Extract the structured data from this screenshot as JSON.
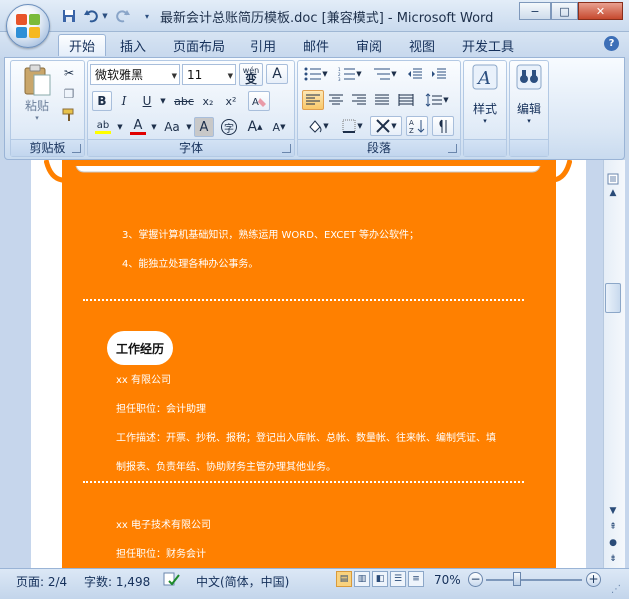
{
  "window": {
    "title": "最新会计总账简历模板.doc [兼容模式] - Microsoft Word",
    "minimize": "−",
    "maximize": "□",
    "close": "✕"
  },
  "qat": {
    "save_icon": "save-icon",
    "undo_icon": "undo-icon",
    "redo_icon": "redo-icon"
  },
  "tabs": [
    "开始",
    "插入",
    "页面布局",
    "引用",
    "邮件",
    "审阅",
    "视图",
    "开发工具"
  ],
  "ribbon": {
    "clipboard": {
      "label": "剪贴板",
      "paste": "粘贴"
    },
    "font": {
      "label": "字体",
      "font_name": "微软雅黑",
      "font_size": "11",
      "wen": "wén",
      "wen_char": "变",
      "a_box": "A",
      "bold": "B",
      "italic": "I",
      "underline": "U",
      "strike": "abc",
      "sub": "x₂",
      "sup": "x²",
      "highlight": "ab",
      "font_color": "A",
      "change_case": "Aa",
      "char_shading": "A",
      "enclose": "字",
      "grow": "A",
      "shrink": "A"
    },
    "paragraph": {
      "label": "段落"
    },
    "styles": {
      "label": "样式"
    },
    "editing": {
      "label": "编辑"
    }
  },
  "document": {
    "line1": "3、掌握计算机基础知识，熟练运用 WORD、EXCET   等办公软件；",
    "line2": "4、能独立处理各种办公事务。",
    "section_title": "工作经历",
    "job1_company": "xx 有限公司",
    "job1_position": "担任职位：会计助理",
    "job1_desc1": "工作描述：开票、抄税、报税；登记出入库帐、总帐、数量帐、往来帐、编制凭证、填",
    "job1_desc2": "制报表、负责年结、协助财务主管办理其他业务。",
    "job2_company": "xx 电子技术有限公司",
    "job2_position": "担任职位：财务会计"
  },
  "status": {
    "page": "页面: 2/4",
    "words": "字数: 1,498",
    "language": "中文(简体，中国)",
    "zoom": "70%",
    "zoom_level_percent": 70
  }
}
